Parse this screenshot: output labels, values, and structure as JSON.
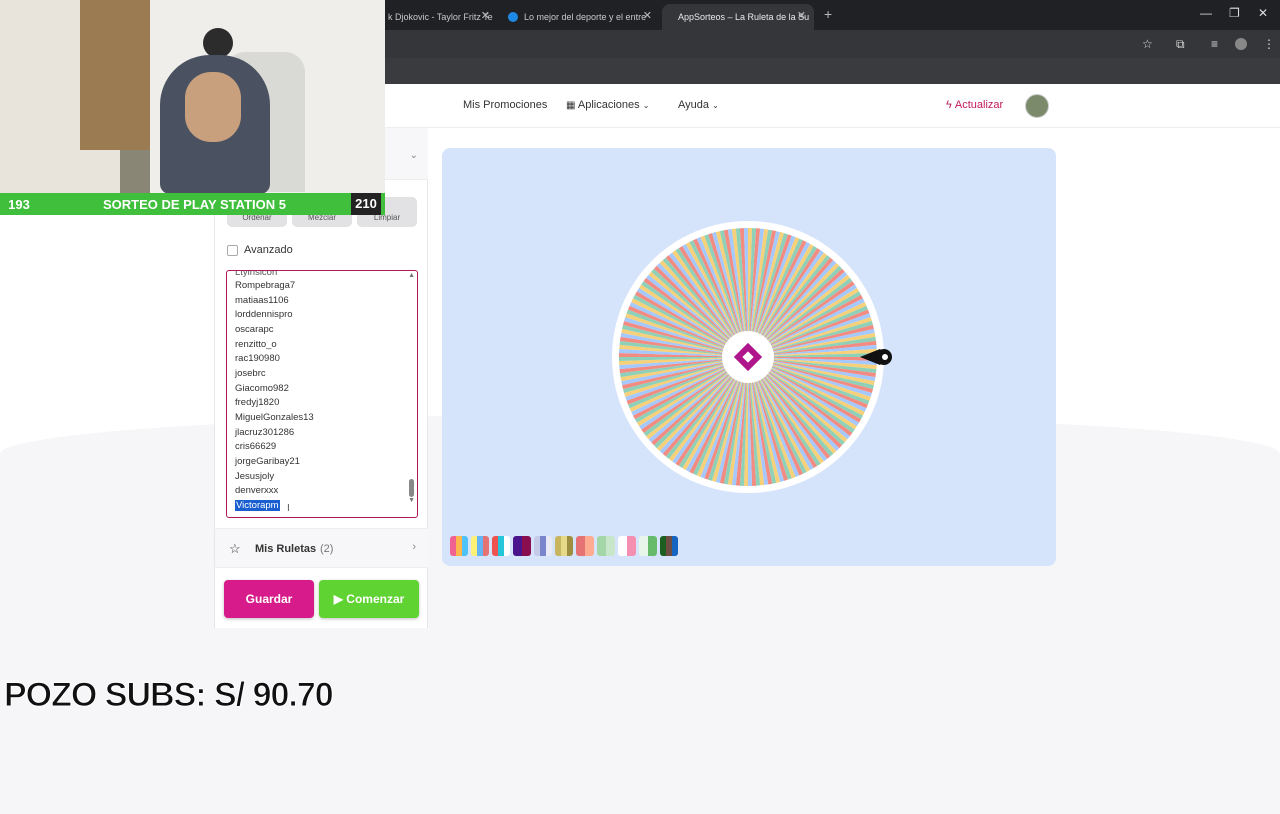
{
  "browser": {
    "tabs": [
      {
        "title": "k Djokovic - Taylor Fritz Te",
        "favicon_color": "#3c3c3c"
      },
      {
        "title": "Lo mejor del deporte y el entre",
        "favicon_color": "#1e88e5"
      },
      {
        "title": "AppSorteos – La Ruleta de la Su",
        "favicon_color": "#c2185b"
      }
    ]
  },
  "nav": {
    "promos": "Mis Promociones",
    "apps": "Aplicaciones",
    "help": "Ayuda",
    "update": "Actualizar"
  },
  "panel": {
    "buttons": [
      "Ordenar",
      "Mezclar",
      "Limpiar"
    ],
    "advanced_label": "Avanzado",
    "advanced_checked": false,
    "entries": [
      "Rompebraga7",
      "matiaas1106",
      "lorddennispro",
      "oscarapc",
      "renzitto_o",
      "rac190980",
      "josebrc",
      "Giacomo982",
      "fredyj1820",
      "MiguelGonzales13",
      "jlacruz301286",
      "cris66629",
      "jorgeGaribay21",
      "Jesusjoly",
      "denverxxx",
      "Victorapm"
    ],
    "selected_entry": "Victorapm",
    "my_wheels_label": "Mis Ruletas",
    "my_wheels_count": "(2)",
    "save": "Guardar",
    "start": "Comenzar"
  },
  "wheel": {
    "colors": [
      "#f28b82",
      "#a5c8ff",
      "#f7d07a",
      "#8fd0b8"
    ],
    "center_color": "#b0168c"
  },
  "overlay": {
    "left_count": "193",
    "title": "SORTEO DE PLAY STATION 5",
    "right_count": "210",
    "pozo": "POZO SUBS: S/ 90.70"
  }
}
